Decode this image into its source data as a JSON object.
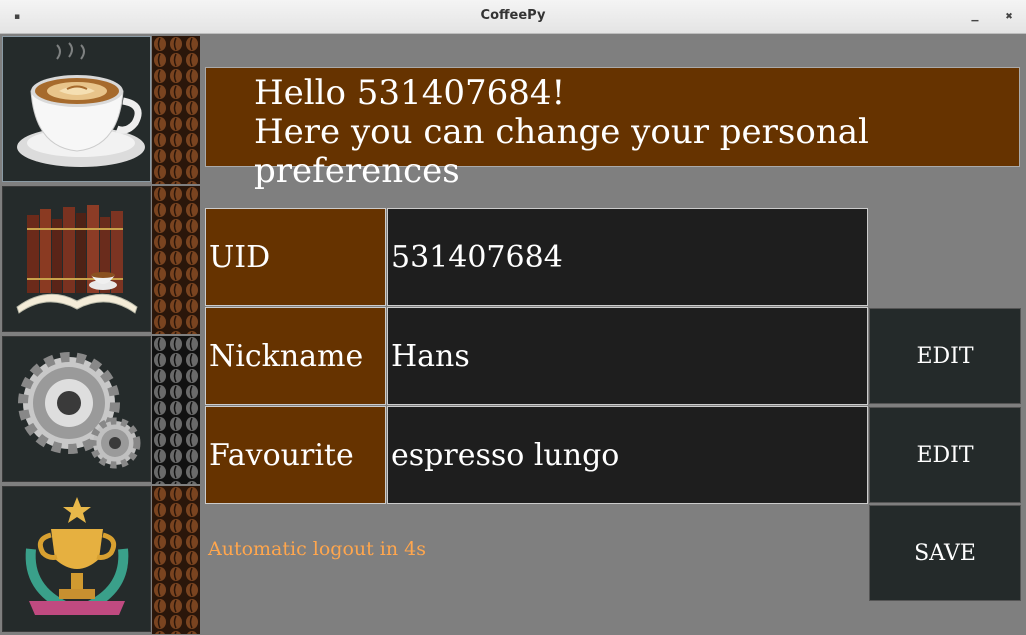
{
  "window": {
    "title": "CoffeePy"
  },
  "sidebar": {
    "items": [
      {
        "name": "coffee-cup",
        "icon": "coffee-cup-icon"
      },
      {
        "name": "books",
        "icon": "books-icon"
      },
      {
        "name": "settings",
        "icon": "gears-icon"
      },
      {
        "name": "trophy",
        "icon": "trophy-icon"
      }
    ]
  },
  "header": {
    "line1": "Hello 531407684!",
    "line2": "Here you can change your personal preferences"
  },
  "fields": {
    "uid": {
      "label": "UID",
      "value": "531407684"
    },
    "nickname": {
      "label": "Nickname",
      "value": "Hans",
      "button": "EDIT"
    },
    "favourite": {
      "label": "Favourite",
      "value": "espresso lungo",
      "button": "EDIT"
    }
  },
  "status": {
    "logout_text": "Automatic logout in 4s"
  },
  "actions": {
    "save_label": "SAVE"
  },
  "colors": {
    "accent": "#663300",
    "background": "#7f7f7f",
    "status": "#ffa64d",
    "button": "#242a2a"
  }
}
